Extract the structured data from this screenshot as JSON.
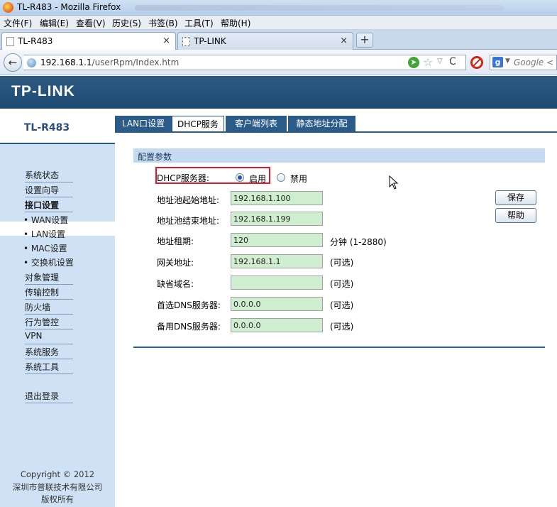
{
  "window": {
    "title": "TL-R483 - Mozilla Firefox"
  },
  "menubar": {
    "items": [
      "文件(F)",
      "编辑(E)",
      "查看(V)",
      "历史(S)",
      "书签(B)",
      "工具(T)",
      "帮助(H)"
    ]
  },
  "tabs": [
    {
      "label": "TL-R483",
      "active": true
    },
    {
      "label": "TP-LINK",
      "active": false
    }
  ],
  "newtab_label": "+",
  "navbar": {
    "url_host": "192.168.1.1",
    "url_path": "/userRpm/Index.htm",
    "search_placeholder": "Google <"
  },
  "page": {
    "brand": "TP-LINK",
    "model": "TL-R483",
    "sidebar": {
      "items": [
        "系统状态",
        "设置向导",
        "接口设置",
        "• WAN设置",
        "• LAN设置",
        "• MAC设置",
        "• 交换机设置",
        "对象管理",
        "传输控制",
        "防火墙",
        "行为管控",
        "VPN",
        "系统服务",
        "系统工具",
        "退出登录"
      ],
      "active_item": "• LAN设置"
    },
    "copyright": [
      "Copyright © 2012",
      "深圳市普联技术有限公司",
      "版权所有"
    ],
    "content_tabs": [
      "LAN口设置",
      "DHCP服务",
      "客户端列表",
      "静态地址分配"
    ],
    "active_content_tab": "DHCP服务",
    "section_title": "配置参数",
    "dhcp": {
      "label": "DHCP服务器:",
      "options": [
        "启用",
        "禁用"
      ],
      "selected": "启用"
    },
    "form": [
      {
        "label": "地址池起始地址:",
        "value": "192.168.1.100",
        "note": ""
      },
      {
        "label": "地址池结束地址:",
        "value": "192.168.1.199",
        "note": ""
      },
      {
        "label": "地址租期:",
        "value": "120",
        "note": "分钟 (1-2880)"
      },
      {
        "label": "网关地址:",
        "value": "192.168.1.1",
        "note": "(可选)"
      },
      {
        "label": "缺省域名:",
        "value": "",
        "note": "(可选)"
      },
      {
        "label": "首选DNS服务器:",
        "value": "0.0.0.0",
        "note": "(可选)"
      },
      {
        "label": "备用DNS服务器:",
        "value": "0.0.0.0",
        "note": "(可选)"
      }
    ],
    "buttons": {
      "save": "保存",
      "help": "帮助"
    }
  },
  "colors": {
    "banner": "#1d4a73",
    "sidebar": "#cfe2f5",
    "field_bg": "#cfeecf",
    "highlight": "#e0182a"
  }
}
